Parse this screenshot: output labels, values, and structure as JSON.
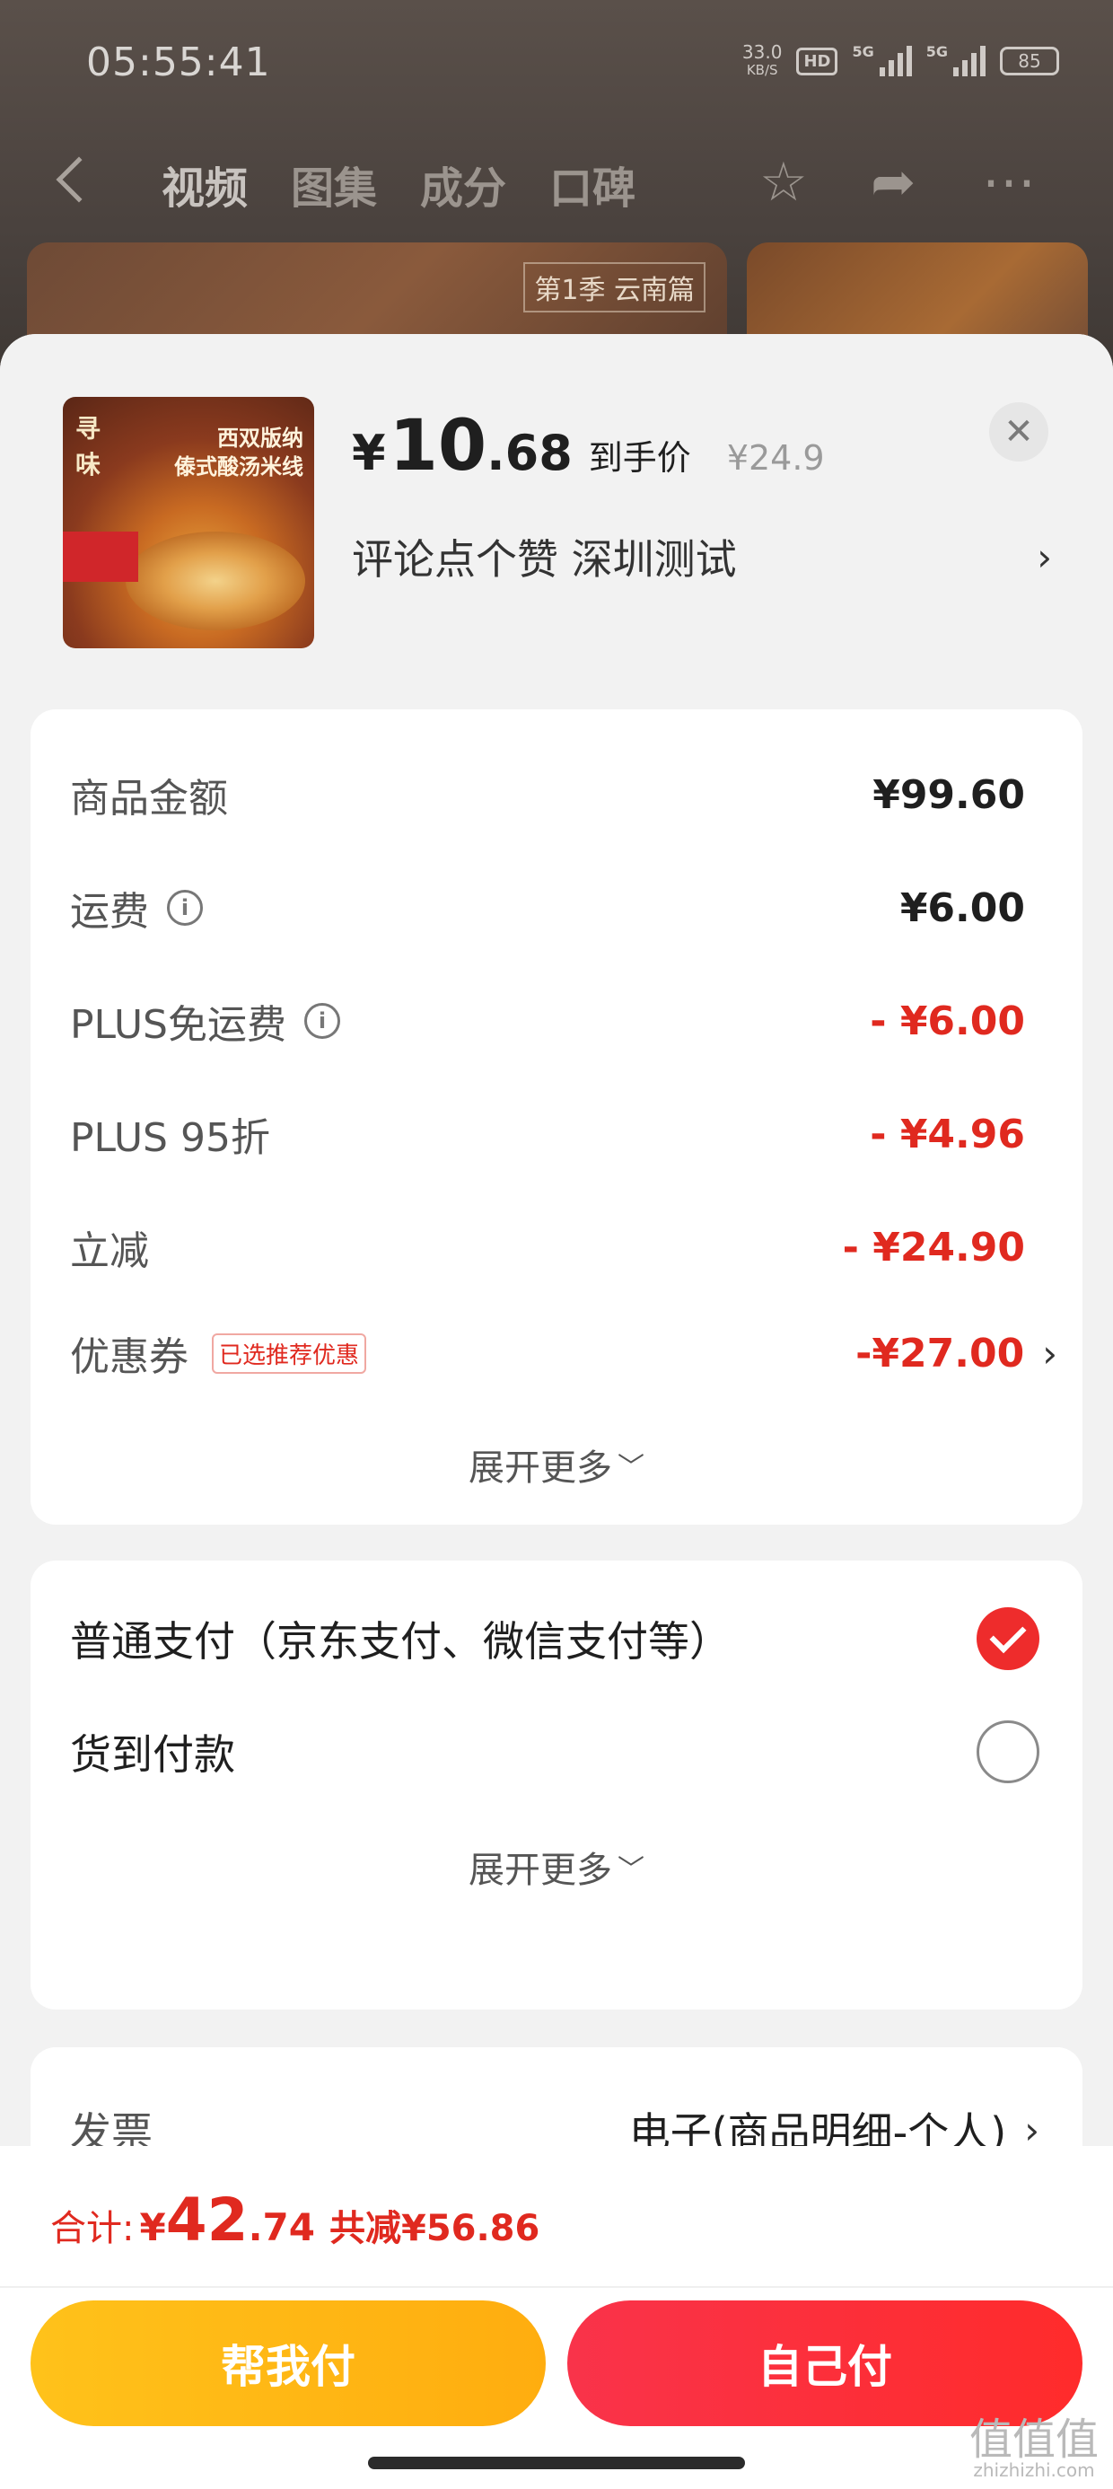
{
  "status_bar": {
    "time": "05:55:41",
    "net_speed_value": "33.0",
    "net_speed_unit": "KB/S",
    "hd_label": "HD",
    "sim1_label": "5G",
    "sim2_label": "5G",
    "battery_level": "85"
  },
  "background_page": {
    "tabs": [
      "视频",
      "图集",
      "成分",
      "口碑"
    ],
    "active_tab": "视频",
    "card_label": "第1季 云南篇"
  },
  "product": {
    "price_symbol": "¥",
    "price_int": "10",
    "price_dec": ".68",
    "price_tag": "到手价",
    "original_price": "¥24.9",
    "address": "评论点个赞  深圳测试",
    "image_title_line1": "西双版纳",
    "image_title_line2": "傣式酸汤米线",
    "image_logo": "寻味"
  },
  "amounts": {
    "rows": [
      {
        "label": "商品金额",
        "value": "¥99.60"
      },
      {
        "label": "运费",
        "value": "¥6.00"
      },
      {
        "label": "PLUS免运费",
        "value": "- ¥6.00"
      },
      {
        "label": "PLUS 95折",
        "value": "- ¥4.96"
      },
      {
        "label": "立减",
        "value": "- ¥24.90"
      },
      {
        "label": "优惠券",
        "value": "-¥27.00",
        "tag": "已选推荐优惠"
      }
    ],
    "expand_label": "展开更多"
  },
  "payment": {
    "options": [
      {
        "label": "普通支付（京东支付、微信支付等）",
        "selected": true
      },
      {
        "label": "货到付款",
        "selected": false
      }
    ],
    "expand_label": "展开更多"
  },
  "invoice": {
    "label": "发票",
    "value": "电子(商品明细-个人)"
  },
  "footer": {
    "total_label": "合计:",
    "total_symbol": "¥",
    "total_int": "42",
    "total_dec": ".74",
    "saved_text": "共减¥56.86",
    "help_pay_label": "帮我付",
    "self_pay_label": "自己付"
  },
  "watermark": {
    "glyphs": "值值值",
    "domain": "zhizhizhi.com"
  },
  "colors": {
    "accent_red": "#e0291f",
    "yellow_button": "#ffb714",
    "red_button": "#f9334a"
  }
}
